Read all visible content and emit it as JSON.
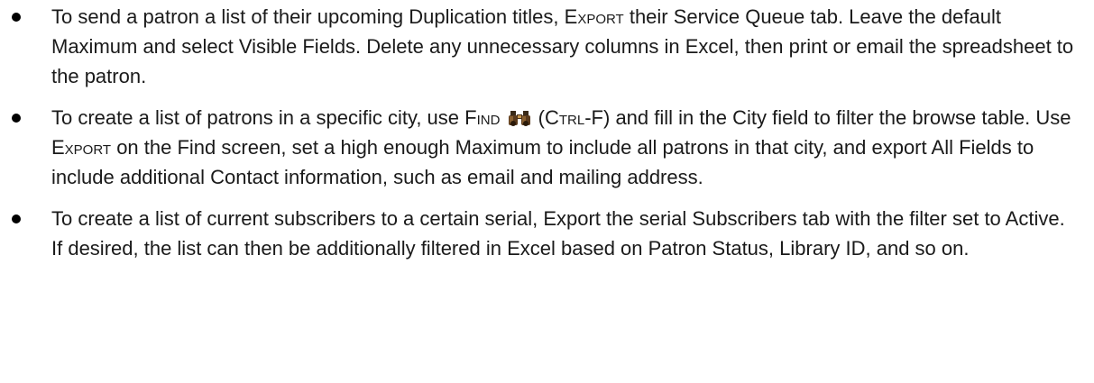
{
  "bullets": [
    {
      "t1": "To send a patron a list of their upcoming Duplication titles, ",
      "k1": "Export",
      "t2": " their Service Queue tab. Leave the default Maximum and select Visible Fields. Delete any unnecessary columns in Excel, then print or email the spreadsheet to the patron."
    },
    {
      "t1": "To create a list of patrons in a specific city, use ",
      "k1": "Find",
      "t2": " (",
      "k2": "Ctrl-F",
      "t3": ") and fill in the City field to filter the browse table. Use ",
      "k3": "Export",
      "t4": " on the Find screen, set a high enough Maximum to include all patrons in that city, and export All Fields to include additional Contact information, such as email and mailing address."
    },
    {
      "t1": "To create a list of current subscribers to a certain serial, Export the serial Subscribers tab with the filter set to Active. If desired, the list can then be additionally filtered in Excel based on Patron Status, Library ID, and so on."
    }
  ],
  "icons": {
    "find": "binoculars-icon"
  }
}
